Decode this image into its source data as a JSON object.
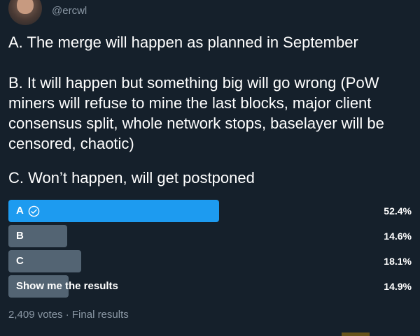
{
  "tweet": {
    "author_handle": "@ercwl",
    "text": {
      "option_a": "A. The merge will happen as planned in September",
      "option_b": "B. It will happen but something big will go wrong (PoW miners will refuse to mine the last blocks, major client consensus split, whole network stops, baselayer will be censored, chaotic)",
      "option_c": "C. Won’t happen, will get postponed"
    }
  },
  "poll": {
    "options": [
      {
        "label": "A",
        "percent_text": "52.4%",
        "percent": 52.4,
        "winner": true
      },
      {
        "label": "B",
        "percent_text": "14.6%",
        "percent": 14.6,
        "winner": false
      },
      {
        "label": "C",
        "percent_text": "18.1%",
        "percent": 18.1,
        "winner": false
      },
      {
        "label": "Show me the results",
        "percent_text": "14.9%",
        "percent": 14.9,
        "winner": false
      }
    ],
    "footer": "2,409 votes · Final results"
  },
  "colors": {
    "background": "#15202b",
    "winner_bar": "#1d9bf0",
    "other_bar": "#536473",
    "secondary_text": "#8b98a5"
  },
  "icons": {
    "winner_marker": "check-circle-icon"
  }
}
